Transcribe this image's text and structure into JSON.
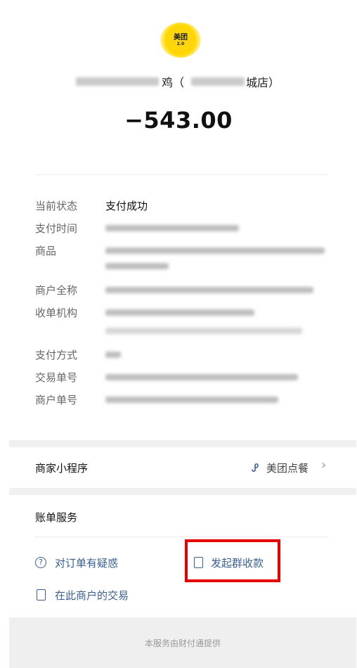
{
  "header": {
    "logo_text": "美团",
    "logo_sub": "2.0",
    "merchant_name_visible_1": "鸡（",
    "merchant_name_visible_2": "城店）",
    "amount": "−543.00"
  },
  "details": {
    "status_label": "当前状态",
    "status_value": "支付成功",
    "pay_time_label": "支付时间",
    "goods_label": "商品",
    "merchant_full_label": "商户全称",
    "acquirer_label": "收单机构",
    "pay_method_label": "支付方式",
    "trade_no_label": "交易单号",
    "merchant_no_label": "商户单号"
  },
  "mini_program": {
    "label": "商家小程序",
    "app_name": "美团点餐",
    "chevron": "›"
  },
  "bill_service": {
    "title": "账单服务",
    "question_label": "对订单有疑惑",
    "group_collect_label": "发起群收款",
    "merchant_trades_label": "在此商户的交易"
  },
  "footer": {
    "text": "本服务由财付通提供"
  },
  "icons": {
    "question": "question-circle-icon",
    "group_collect": "receipt-icon",
    "trades": "document-icon",
    "mini_program": "mini-program-icon"
  },
  "colors": {
    "link": "#3a5f8f",
    "highlight": "#e60000",
    "brand_yellow": "#ffd700"
  }
}
